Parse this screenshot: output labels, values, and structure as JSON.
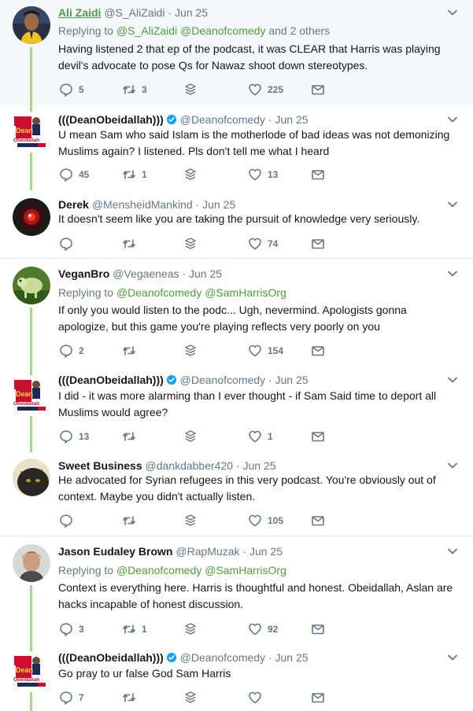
{
  "tweets": [
    {
      "name": "Ali Zaidi",
      "handle": "@S_AliZaidi",
      "dot": "·",
      "date": "Jun 25",
      "reply_prefix": "Replying to",
      "reply_handles": "@S_AliZaidi @Deanofcomedy",
      "reply_suffix": " and 2 others",
      "text": "Having listened 2 that ep of the podcast, it was CLEAR that Harris was playing devil's advocate to pose Qs for Nawaz shoot down stereotypes.",
      "replies": "5",
      "retweets": "3",
      "likes": "225"
    },
    {
      "name": "(((DeanObeidallah)))",
      "handle": "@Deanofcomedy",
      "dot": "·",
      "date": "Jun 25",
      "avatar_text": "Dean Obeidallah",
      "text": "U mean Sam who said Islam is the motherlode of bad ideas was not demonizing Muslims again? I listened. Pls don't tell me what I heard",
      "replies": "45",
      "retweets": "1",
      "likes": "13"
    },
    {
      "name": "Derek",
      "handle": "@MensheidMankind",
      "dot": "·",
      "date": "Jun 25",
      "text": "It doesn't seem like you are taking the pursuit of knowledge very seriously.",
      "replies": "",
      "retweets": "",
      "likes": "74"
    },
    {
      "name": "VeganBro",
      "handle": "@Vegaeneas",
      "dot": "·",
      "date": "Jun 25",
      "reply_prefix": "Replying to",
      "reply_handles": "@Deanofcomedy @SamHarrisOrg",
      "text": "If only you would listen to the podc... Ugh, nevermind. Apologists gonna apologize, but this game you're playing reflects very poorly on you",
      "replies": "2",
      "retweets": "",
      "likes": "154"
    },
    {
      "name": "(((DeanObeidallah)))",
      "handle": "@Deanofcomedy",
      "dot": "·",
      "date": "Jun 25",
      "avatar_text": "Dean Obeidallah",
      "text": "I did - it was more alarming than I ever thought -  if Sam Said time to deport all Muslims would agree?",
      "replies": "13",
      "retweets": "",
      "likes": "1"
    },
    {
      "name": "Sweet Business",
      "handle": "@dankdabber420",
      "dot": "·",
      "date": "Jun 25",
      "text": "He advocated for Syrian refugees in this very podcast. You're obviously out of context. Maybe you didn't actually listen.",
      "replies": "",
      "retweets": "",
      "likes": "105"
    },
    {
      "name": "Jason Eudaley Brown",
      "handle": "@RapMuzak",
      "dot": "·",
      "date": "Jun 25",
      "reply_prefix": "Replying to",
      "reply_handles": "@Deanofcomedy @SamHarrisOrg",
      "text": "Context is everything here. Harris is thoughtful and honest. Obeidallah, Aslan are hacks incapable of honest discussion.",
      "replies": "3",
      "retweets": "1",
      "likes": "92"
    },
    {
      "name": "(((DeanObeidallah)))",
      "handle": "@Deanofcomedy",
      "dot": "·",
      "date": "Jun 25",
      "avatar_text": "Dean Obeidallah",
      "text": "Go pray to ur false God Sam Harris",
      "replies": "7",
      "retweets": "",
      "likes": ""
    }
  ],
  "colors": {
    "accent": "#4f9d3a",
    "thread": "#a5d68a",
    "muted": "#657786",
    "verified": "#1da1f2",
    "highlight_bg": "#f5f8fa"
  },
  "icons": [
    "reply-icon",
    "retweet-icon",
    "dm-stack-icon",
    "like-icon",
    "mail-icon",
    "chevron-down-icon",
    "verified-icon"
  ]
}
